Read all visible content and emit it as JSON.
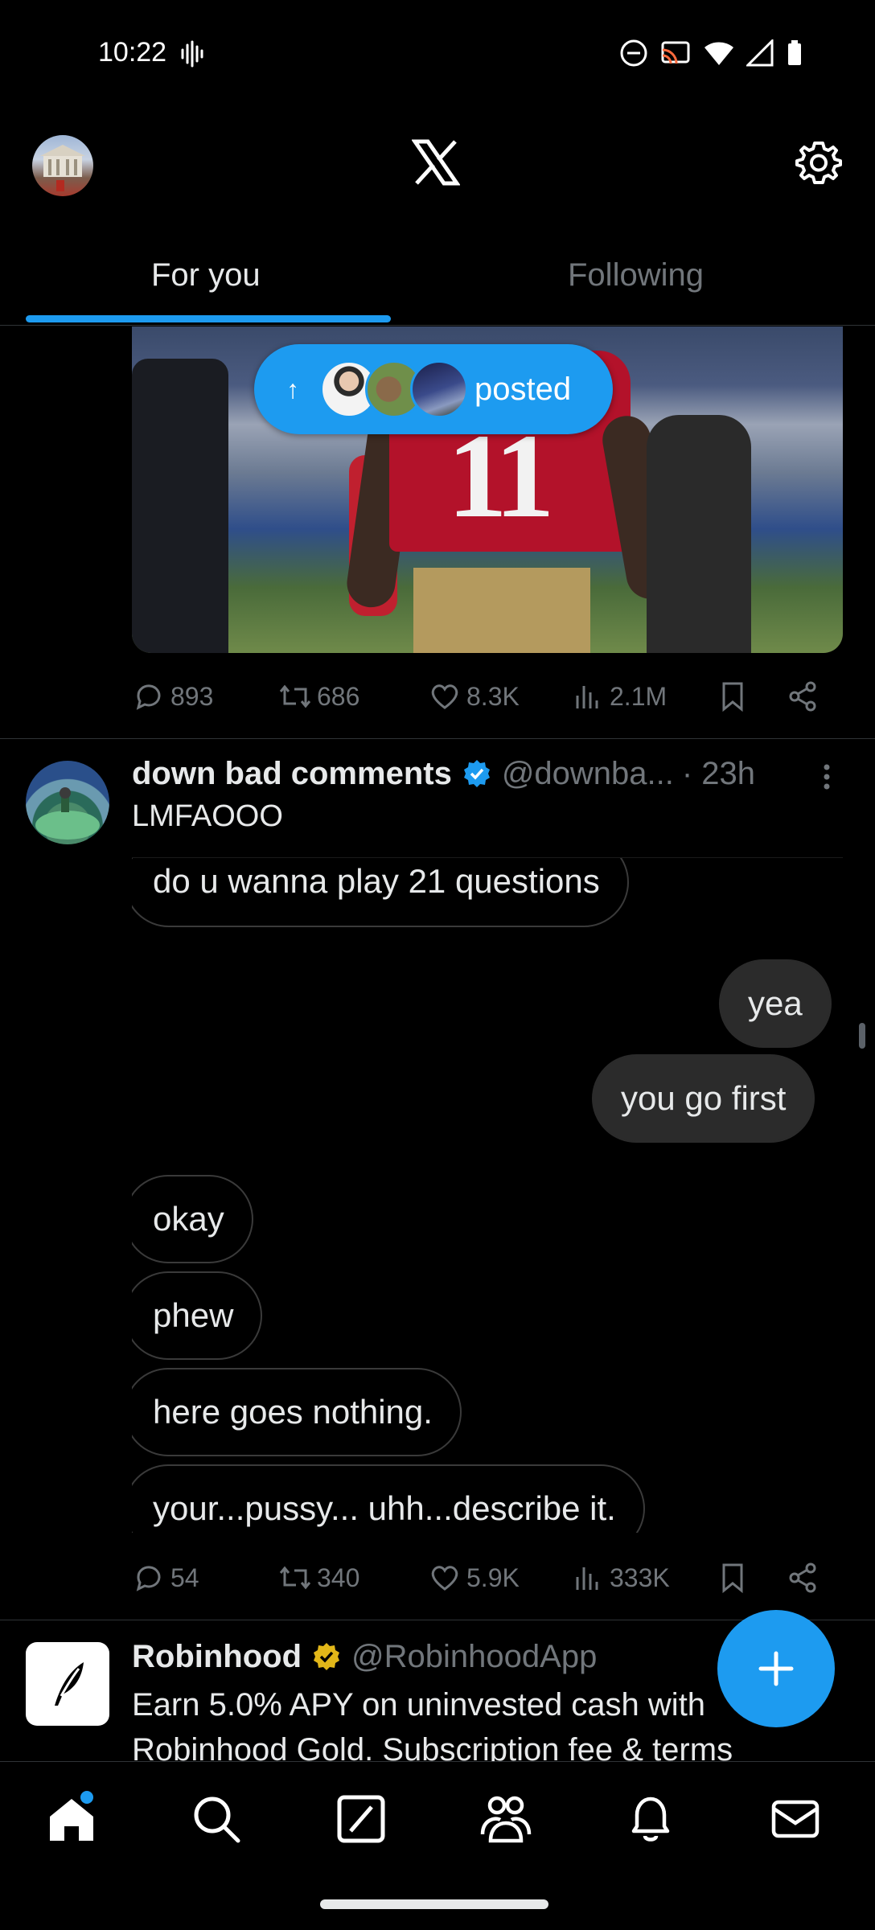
{
  "status_bar": {
    "time": "10:22"
  },
  "header": {
    "tabs": [
      {
        "label": "For you",
        "active": true
      },
      {
        "label": "Following",
        "active": false
      }
    ]
  },
  "posted_pill": {
    "label": "posted"
  },
  "post1": {
    "replies": "893",
    "reposts": "686",
    "likes": "8.3K",
    "views": "2.1M"
  },
  "post2": {
    "name": "down bad comments",
    "handle": "@downba...",
    "time": "· 23h",
    "text": "LMFAOOO",
    "messages": [
      {
        "text": "do u wanna play 21 questions",
        "side": "left"
      },
      {
        "text": "yea",
        "side": "right"
      },
      {
        "text": "you go first",
        "side": "right"
      },
      {
        "text": "okay",
        "side": "left"
      },
      {
        "text": "phew",
        "side": "left"
      },
      {
        "text": "here goes nothing.",
        "side": "left"
      },
      {
        "text": "your...pussy... uhh...describe it.",
        "side": "left"
      }
    ],
    "replies": "54",
    "reposts": "340",
    "likes": "5.9K",
    "views": "333K"
  },
  "ad": {
    "name": "Robinhood",
    "handle": "@RobinhoodApp",
    "text_line1": "Earn 5.0% APY on uninvested cash with",
    "text_line2": "Robinhood Gold. Subscription fee & terms"
  },
  "colors": {
    "accent": "#1d9bf0",
    "gold_badge": "#e2b719",
    "secondary_text": "#71767b"
  },
  "icons": {
    "nav": [
      "home-icon",
      "search-icon",
      "grok-icon",
      "communities-icon",
      "notifications-icon",
      "messages-icon"
    ]
  }
}
